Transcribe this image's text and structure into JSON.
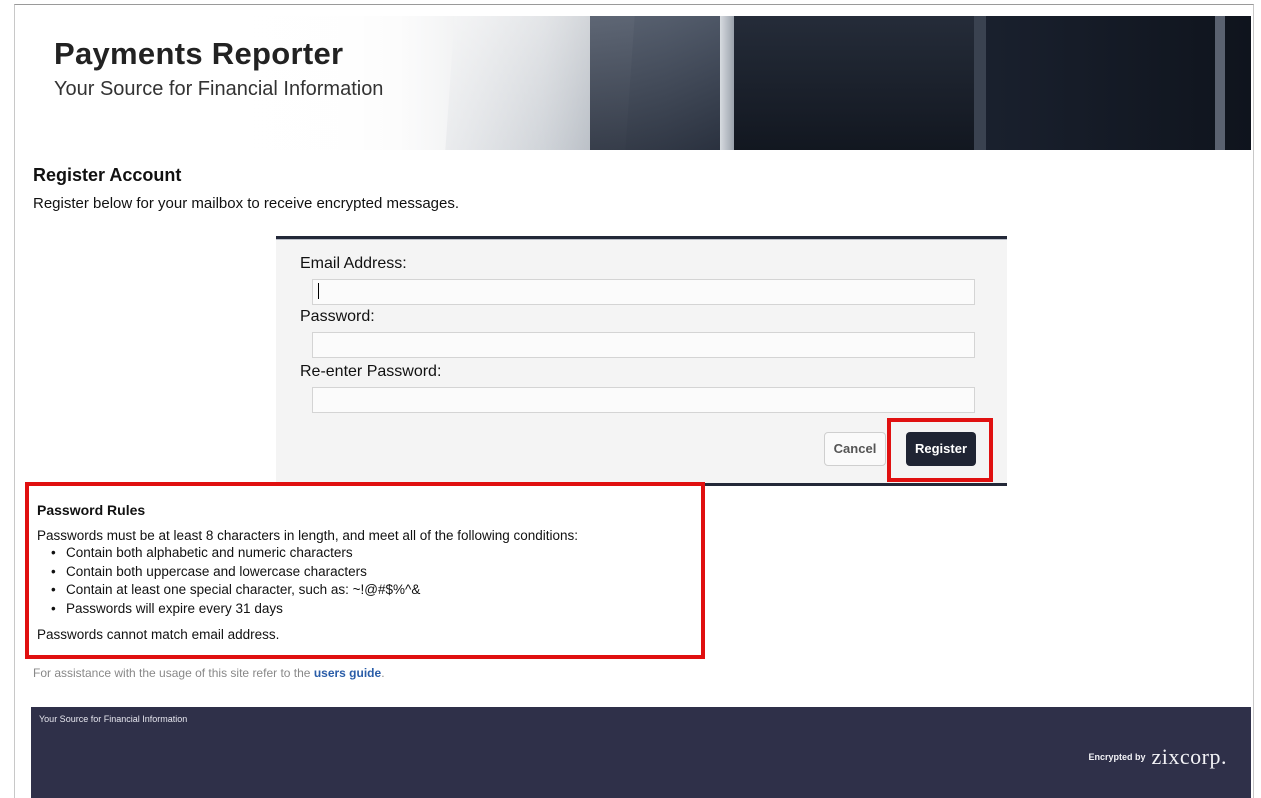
{
  "banner": {
    "title": "Payments Reporter",
    "subtitle": "Your Source for Financial Information"
  },
  "page": {
    "title": "Register Account",
    "description": "Register below for your mailbox to receive encrypted messages."
  },
  "form": {
    "email_label": "Email Address:",
    "email_value": "",
    "password_label": "Password:",
    "password_value": "",
    "reenter_label": "Re-enter Password:",
    "reenter_value": "",
    "cancel_label": "Cancel",
    "register_label": "Register"
  },
  "password_rules": {
    "title": "Password Rules",
    "intro": "Passwords must be at least 8 characters in length, and meet all of the following conditions:",
    "items": [
      "Contain both alphabetic and numeric characters",
      "Contain both uppercase and lowercase characters",
      "Contain at least one special character, such as: ~!@#$%^&",
      "Passwords will expire every 31 days"
    ],
    "footer": "Passwords cannot match email address."
  },
  "assistance": {
    "text": "For assistance with the usage of this site refer to the",
    "link_label": "users guide",
    "suffix": "."
  },
  "footer": {
    "text": "Your Source for Financial Information",
    "encrypted_by": "Encrypted by",
    "brand": "zixcorp."
  },
  "colors": {
    "highlight": "#e01010",
    "footer_bg": "#2f3049",
    "register_bg": "#1f2433",
    "link": "#2a5da8"
  }
}
